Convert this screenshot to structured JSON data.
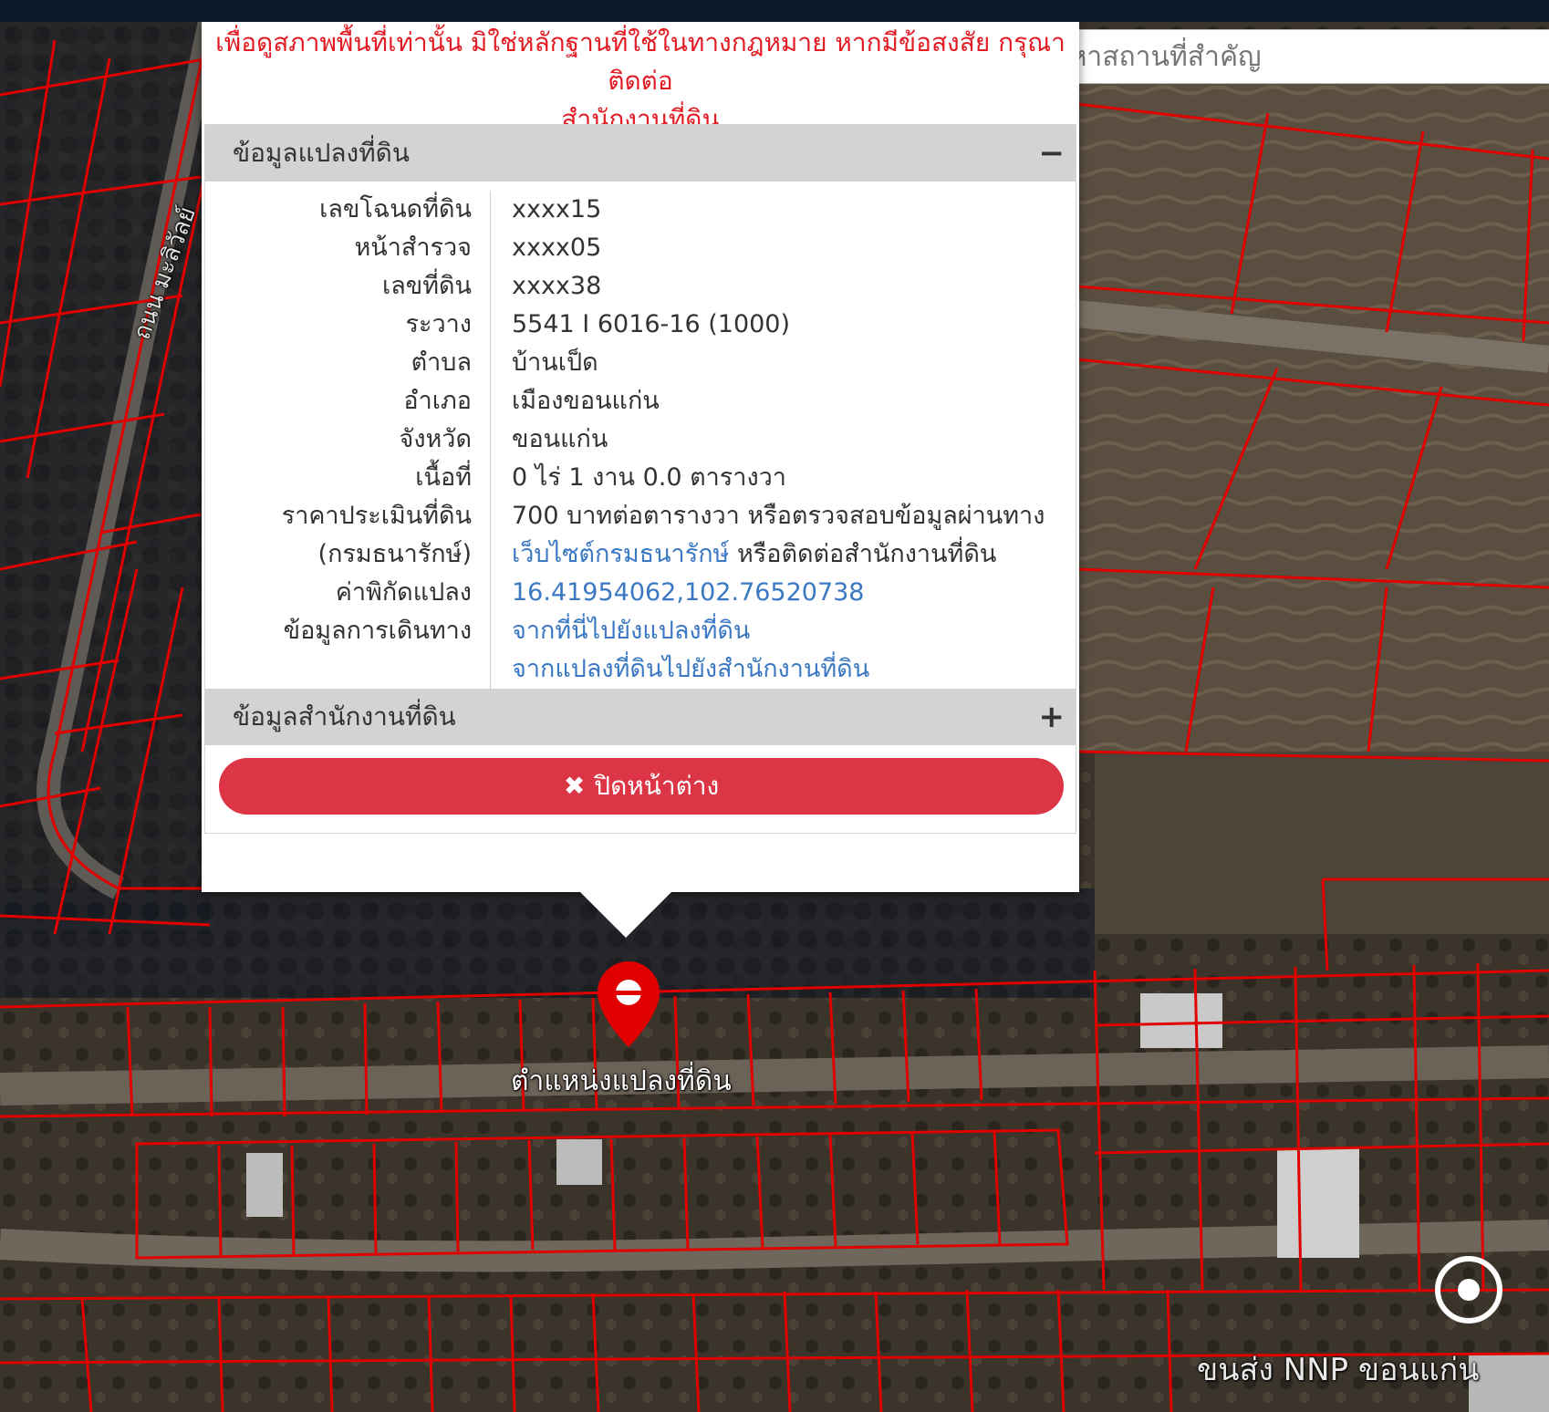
{
  "map": {
    "parcel_marker_label": "ตำแหน่งแปลงที่ดิน",
    "poi_label": "ขนส่ง NNP ขอนแก่น",
    "road_label": "ถนน มะลิวัลย์"
  },
  "search": {
    "placeholder": "ค้นหาสถานที่สำคัญ"
  },
  "popup": {
    "disclaimer_line1": "เพื่อดูสภาพพื้นที่เท่านั้น มิใช่หลักฐานที่ใช้ในทางกฎหมาย หากมีข้อสงสัย กรุณาติดต่อ",
    "disclaimer_line2": "สำนักงานที่ดิน",
    "parcel_section": {
      "title": "ข้อมูลแปลงที่ดิน",
      "toggle": "−",
      "fields": {
        "deed_no_label": "เลขโฉนดที่ดิน",
        "deed_no": "xxxx15",
        "survey_page_label": "หน้าสำรวจ",
        "survey_page": "xxxx05",
        "land_no_label": "เลขที่ดิน",
        "land_no": "xxxx38",
        "sheet_label": "ระวาง",
        "sheet": "5541 I 6016-16 (1000)",
        "subdistrict_label": "ตำบล",
        "subdistrict": "บ้านเป็ด",
        "district_label": "อำเภอ",
        "district": "เมืองขอนแก่น",
        "province_label": "จังหวัด",
        "province": "ขอนแก่น",
        "area_label": "เนื้อที่",
        "area": "0 ไร่ 1 งาน 0.0 ตารางวา",
        "appraisal_label": "ราคาประเมินที่ดิน",
        "appraisal": "700 บาทต่อตารางวา หรือตรวจสอบข้อมูลผ่านทาง",
        "appraisal_label2": "(กรมธนารักษ์)",
        "appraisal_link": "เว็บไซต์กรมธนารักษ์",
        "appraisal_rest": " หรือติดต่อสำนักงานที่ดิน",
        "coords_label": "ค่าพิกัดแปลง",
        "coords": "16.41954062,102.76520738",
        "nav_label": "ข้อมูลการเดินทาง",
        "nav_link1": "จากที่นี่ไปยังแปลงที่ดิน",
        "nav_link2": "จากแปลงที่ดินไปยังสำนักงานที่ดิน"
      }
    },
    "office_section": {
      "title": "ข้อมูลสำนักงานที่ดิน",
      "toggle": "+"
    },
    "close_label": "ปิดหน้าต่าง",
    "close_icon": "✖"
  },
  "colors": {
    "parcel_line": "#e00000",
    "close_button": "#dc3545",
    "link": "#3b78c3",
    "disclaimer": "#e31b23"
  }
}
